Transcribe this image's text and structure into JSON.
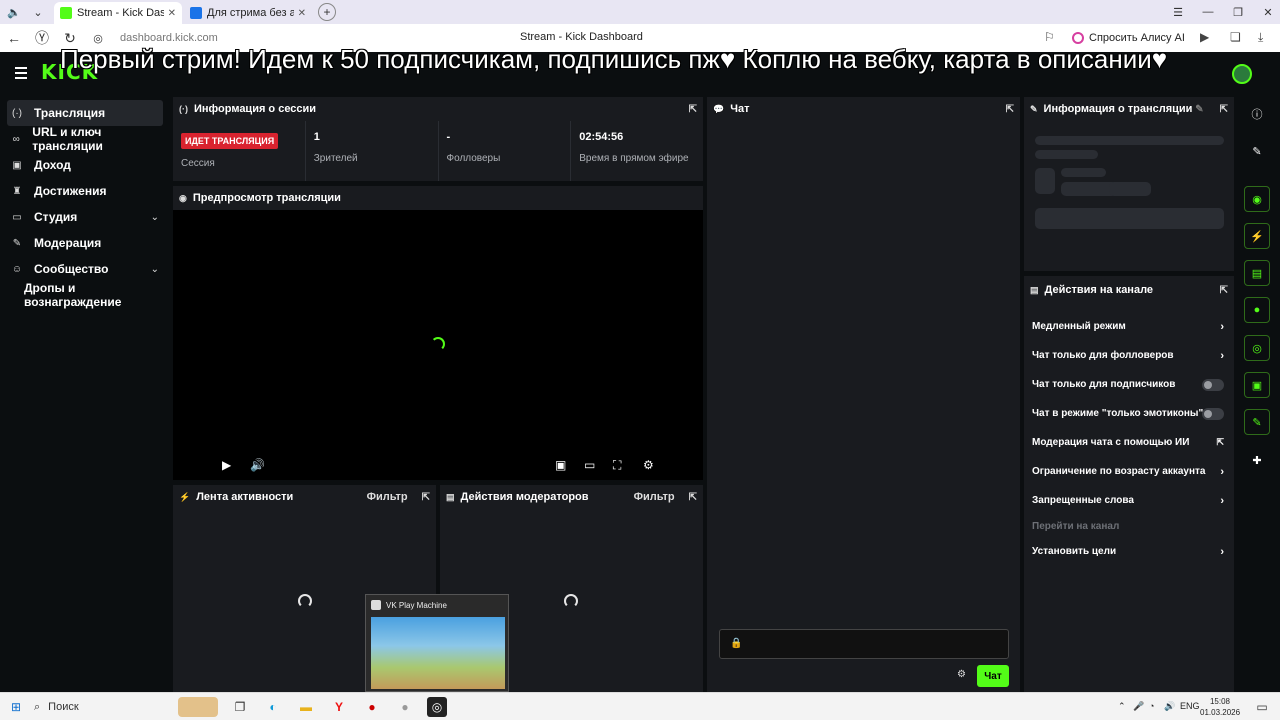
{
  "browser": {
    "tabs": [
      {
        "title": "Stream - Kick Dashboard",
        "active": true,
        "favicon_color": "#53fc18"
      },
      {
        "title": "Для стрима без авто",
        "active": false,
        "favicon_color": "#1a73e8"
      }
    ],
    "url": "dashboard.kick.com",
    "page_title": "Stream - Kick Dashboard",
    "alisa_label": "Спросить Алису AI"
  },
  "overlay_banner": "Первый стрим! Идем к 50 подписчикам, подпишись пж♥ Коплю на вебку, карта в описании♥",
  "kick": {
    "logo": "KICK",
    "sidebar": [
      {
        "label": "Трансляция",
        "icon": "(·)",
        "active": true,
        "chevron": false
      },
      {
        "label": "URL и ключ трансляции",
        "icon": "∞",
        "active": false,
        "chevron": false
      },
      {
        "label": "Доход",
        "icon": "▣",
        "active": false,
        "chevron": false
      },
      {
        "label": "Достижения",
        "icon": "♜",
        "active": false,
        "chevron": false
      },
      {
        "label": "Студия",
        "icon": "▭",
        "active": false,
        "chevron": true
      },
      {
        "label": "Модерация",
        "icon": "✎",
        "active": false,
        "chevron": false
      },
      {
        "label": "Сообщество",
        "icon": "☺",
        "active": false,
        "chevron": true
      }
    ],
    "sidebar_sub": "Дропы и вознаграждение",
    "session": {
      "title": "Информация о сессии",
      "live_badge": "ИДЕТ ТРАНСЛЯЦИЯ",
      "session_label": "Сессия",
      "viewers_value": "1",
      "viewers_label": "Зрителей",
      "followers_value": "-",
      "followers_label": "Фолловеры",
      "time_value": "02:54:56",
      "time_label": "Время в прямом эфире"
    },
    "preview": {
      "title": "Предпросмотр трансляции"
    },
    "activity": {
      "title": "Лента активности",
      "filter": "Фильтр"
    },
    "modactions": {
      "title": "Действия модераторов",
      "filter": "Фильтр"
    },
    "chat": {
      "title": "Чат",
      "send_label": "Чат"
    },
    "stream_info": {
      "title": "Информация о трансляции"
    },
    "channel_actions": {
      "title": "Действия на канале",
      "rows": [
        {
          "label": "Медленный режим",
          "kind": "arrow"
        },
        {
          "label": "Чат только для фолловеров",
          "kind": "arrow"
        },
        {
          "label": "Чат только для подписчиков",
          "kind": "toggle"
        },
        {
          "label": "Чат в режиме \"только эмотиконы\"",
          "kind": "toggle"
        },
        {
          "label": "Модерация чата с помощью ИИ",
          "kind": "ext"
        },
        {
          "label": "Ограничение по возрасту аккаунта",
          "kind": "arrow"
        },
        {
          "label": "Запрещенные слова",
          "kind": "arrow"
        },
        {
          "label": "Перейти на канал",
          "kind": "muted"
        },
        {
          "label": "Установить цели",
          "kind": "arrow"
        }
      ]
    }
  },
  "popup": {
    "title": "VK Play Machine"
  },
  "taskbar": {
    "search_label": "Поиск",
    "lang": "ENG",
    "time": "15:08",
    "date": "01.03.2026"
  }
}
